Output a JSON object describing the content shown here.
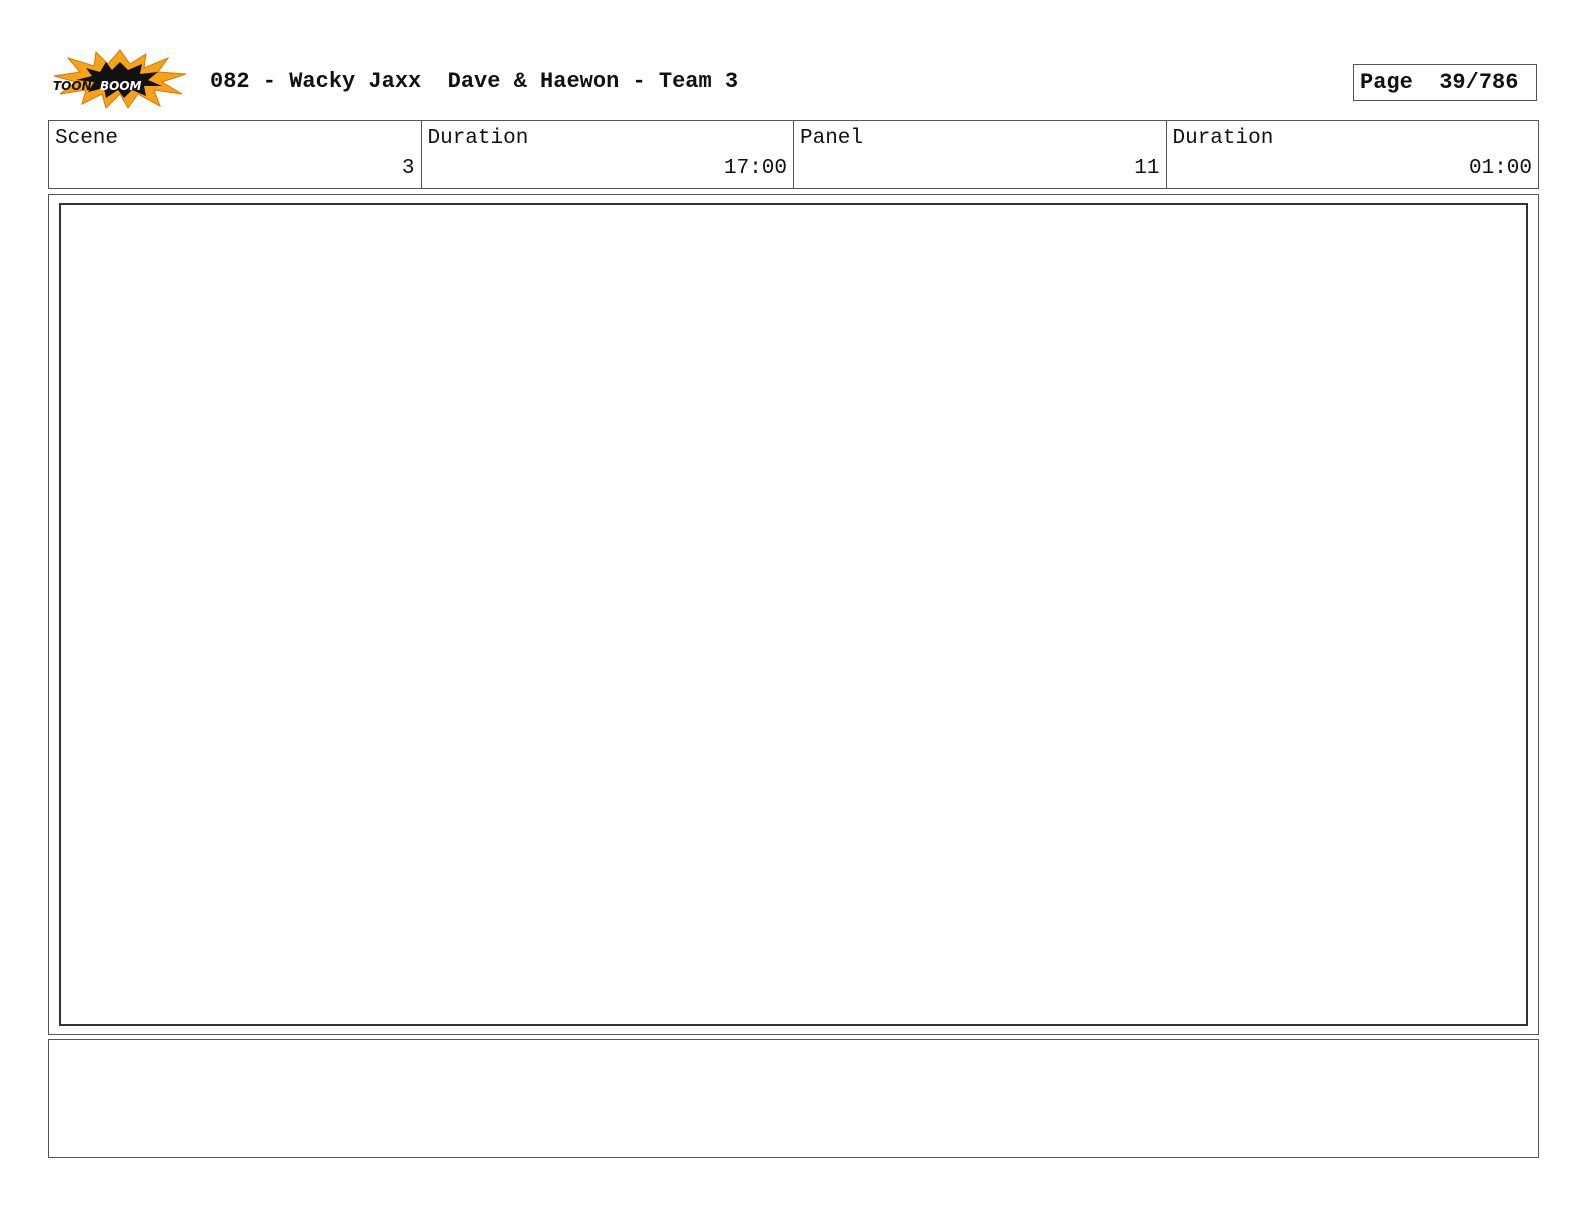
{
  "header": {
    "logo_text": "TOON BOOM",
    "title": "082 - Wacky Jaxx  Dave & Haewon - Team 3",
    "page_label": "Page  39/786"
  },
  "info": [
    {
      "label": "Scene",
      "value": "3"
    },
    {
      "label": "Duration",
      "value": "17:00"
    },
    {
      "label": "Panel",
      "value": "11"
    },
    {
      "label": "Duration",
      "value": "01:00"
    }
  ],
  "colors": {
    "logo_burst_outer": "#f7a21b",
    "logo_burst_inner": "#111111",
    "border": "#555555"
  },
  "icons": {
    "logo": "toon-boom-logo-icon"
  }
}
